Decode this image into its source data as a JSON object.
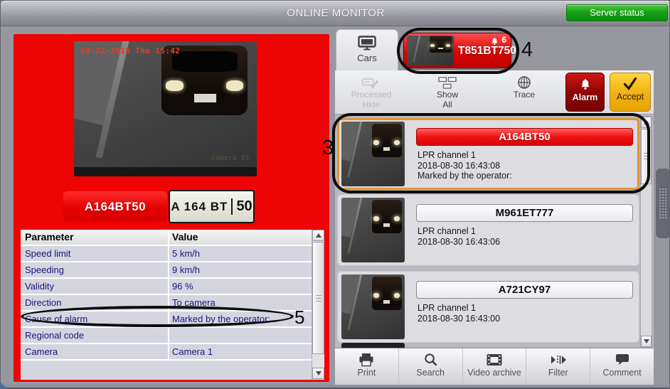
{
  "header": {
    "title": "ONLINE MONITOR",
    "server_status_label": "Server status"
  },
  "detail": {
    "camera": {
      "timestamp": "10-22-2015 Thu 15:42",
      "camera_label": "Camera 01"
    },
    "recognized_plate": "A164BT50",
    "plate_image": {
      "text": "A 164 BT",
      "region": "50"
    },
    "table": {
      "headers": [
        "Parameter",
        "Value"
      ],
      "rows": [
        {
          "parameter": "Speed limit",
          "value": "5 km/h"
        },
        {
          "parameter": "Speeding",
          "value": "9 km/h"
        },
        {
          "parameter": "Validity",
          "value": "96 %"
        },
        {
          "parameter": "Direction",
          "value": "To camera"
        },
        {
          "parameter": "Cause of alarm",
          "value": "Marked by the operator:"
        },
        {
          "parameter": "Regional code",
          "value": ""
        },
        {
          "parameter": "Camera",
          "value": "Camera 1"
        }
      ]
    }
  },
  "monitor": {
    "cars_tab_label": "Cars",
    "alarm_tab": {
      "plate": "T851BT750",
      "badge": "6"
    },
    "toolbar": {
      "processed": [
        "Processed",
        "Hide"
      ],
      "show_all": [
        "Show",
        "All"
      ],
      "trace": "Trace",
      "alarm": "Alarm",
      "accept": "Accept"
    },
    "events": [
      {
        "plate": "A164BT50",
        "channel": "LPR channel 1",
        "timestamp": "2018-08-30 16:43:08",
        "note": "Marked by the operator:"
      },
      {
        "plate": "M961ET777",
        "channel": "LPR channel 1",
        "timestamp": "2018-08-30 16:43:06"
      },
      {
        "plate": "A721CY97",
        "channel": "LPR channel 1",
        "timestamp": "2018-08-30 16:43:00"
      }
    ],
    "bottom_toolbar": [
      "Print",
      "Search",
      "Video archive",
      "Filter",
      "Comment"
    ]
  },
  "annotations": {
    "label_3": "3",
    "label_4": "4",
    "label_5": "5"
  },
  "colors": {
    "panel_red": "#ee0404",
    "alarm_red": "#a60505",
    "accept_amber": "#f2b511",
    "server_green": "#16a214",
    "selection_orange": "#e2952f",
    "table_text_navy": "#15157d"
  }
}
